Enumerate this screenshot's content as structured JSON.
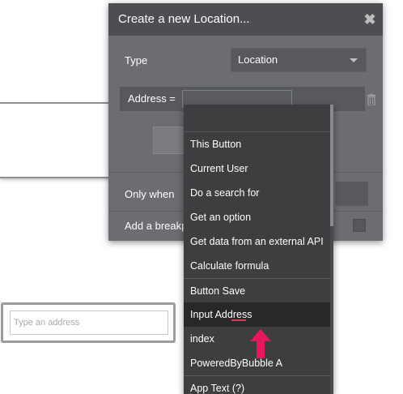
{
  "canvas": {
    "address_input": {
      "placeholder": "Type an address"
    }
  },
  "modal": {
    "title": "Create a new Location...",
    "close_label": "✖",
    "type_label": "Type",
    "type_value": "Location",
    "address_label": "Address  =",
    "only_when_label": "Only when",
    "add_breakpoint_label": "Add a breakp"
  },
  "dropdown": {
    "items": [
      {
        "label": "This Button",
        "separator_before": false,
        "active": false
      },
      {
        "label": "Current User",
        "separator_before": false,
        "active": false
      },
      {
        "label": "Do a search for",
        "separator_before": false,
        "active": false
      },
      {
        "label": "Get an option",
        "separator_before": false,
        "active": false
      },
      {
        "label": "Get data from an external API",
        "separator_before": false,
        "active": false
      },
      {
        "label": "Calculate formula",
        "separator_before": false,
        "active": false
      },
      {
        "label": "Button Save",
        "separator_before": true,
        "active": false
      },
      {
        "label": "Input Address",
        "separator_before": false,
        "active": true
      },
      {
        "label": "index",
        "separator_before": false,
        "active": false
      },
      {
        "label": "PoweredByBubble A",
        "separator_before": false,
        "active": false
      },
      {
        "label": "App Text (?)",
        "separator_before": true,
        "active": false
      }
    ]
  },
  "colors": {
    "panel_bg": "#6b6d70",
    "panel_header": "#4c4e51",
    "dropdown_bg": "#3d3e40",
    "arrow": "#e8175d"
  },
  "icons": [
    "close-icon",
    "chevron-down-icon",
    "trash-icon",
    "up-arrow-annotation-icon"
  ]
}
